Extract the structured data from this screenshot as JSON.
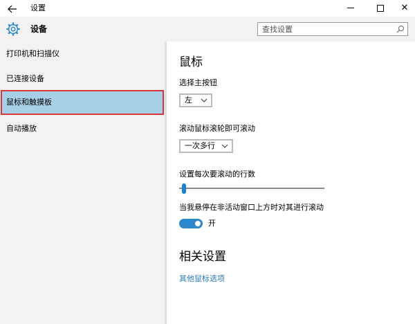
{
  "window": {
    "title": "设置",
    "back_icon": "back-arrow-icon",
    "close_glyph": "✕"
  },
  "header": {
    "title": "设备",
    "icon": "gear-icon",
    "search": {
      "placeholder": "查找设置",
      "value": ""
    }
  },
  "sidebar": {
    "items": [
      {
        "label": "打印机和扫描仪",
        "active": false
      },
      {
        "label": "已连接设备",
        "active": false
      },
      {
        "label": "鼠标和触摸板",
        "active": true
      },
      {
        "label": "自动播放",
        "active": false
      }
    ]
  },
  "main": {
    "heading": "鼠标",
    "primary_button": {
      "label": "选择主按钮",
      "value": "左"
    },
    "scroll_mode": {
      "label": "滚动鼠标滚轮即可滚动",
      "value": "一次多行"
    },
    "lines_to_scroll": {
      "label": "设置每次要滚动的行数",
      "value_fraction": 0.02
    },
    "inactive_scroll": {
      "label": "当我悬停在非活动窗口上方时对其进行滚动",
      "state_label": "开",
      "on": true
    },
    "related_heading": "相关设置",
    "related_link": "其他鼠标选项"
  },
  "colors": {
    "accent": "#2b87c9",
    "selected_bg": "#a8cfe8",
    "highlight_border": "#d9343a",
    "link": "#2d7bbe"
  }
}
